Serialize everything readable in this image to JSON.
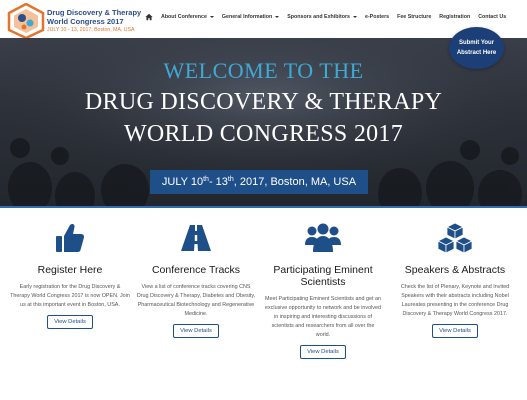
{
  "header": {
    "logo_title_line1": "Drug Discovery & Therapy",
    "logo_title_line2": "World Congress 2017",
    "logo_subtitle": "JULY 10 - 13, 2017, Boston, MA, USA",
    "nav": [
      {
        "label": "About Conference",
        "dropdown": true
      },
      {
        "label": "General Information",
        "dropdown": true
      },
      {
        "label": "Sponsors and Exhibitors",
        "dropdown": true
      },
      {
        "label": "e-Posters",
        "dropdown": false
      },
      {
        "label": "Fee Structure",
        "dropdown": false
      },
      {
        "label": "Registration",
        "dropdown": false
      },
      {
        "label": "Contact Us",
        "dropdown": false
      }
    ],
    "submit_label": "Submit Your Abstract Here"
  },
  "hero": {
    "line1": "WELCOME TO THE",
    "line2": "DRUG DISCOVERY & THERAPY",
    "line3": "WORLD CONGRESS 2017",
    "date_part1": "JULY 10",
    "date_sup1": "th",
    "date_part2": " - 13",
    "date_sup2": "th",
    "date_part3": ", 2017, Boston, MA, USA"
  },
  "features": [
    {
      "icon": "thumbs-up-icon",
      "title": "Register Here",
      "description": "Early registration for the Drug Discovery & Therapy World Congress 2017 is now OPEN. Join us at this important event in Boston, USA.",
      "button": "View Details"
    },
    {
      "icon": "road-icon",
      "title": "Conference Tracks",
      "description": "View a list of conference tracks covering CNS Drug Discovery & Therapy, Diabetes and Obesity, Pharmaceutical Biotechnology and Regenerative Medicine.",
      "button": "View Details"
    },
    {
      "icon": "users-icon",
      "title": "Participating Eminent Scientists",
      "description": "Meet Participating Eminent Scientists and get an exclusive opportunity to network and be involved in inspiring and interesting discussions of scientists and researchers from all over the world.",
      "button": "View Details"
    },
    {
      "icon": "cubes-icon",
      "title": "Speakers & Abstracts",
      "description": "Check the list of Plenary, Keynote and Invited Speakers with their abstracts including Nobel Laureates presenting in the conference Drug Discovery & Therapy World Congress 2017.",
      "button": "View Details"
    }
  ],
  "colors": {
    "brand_navy": "#1f4f88",
    "accent_blue": "#3fa9d6",
    "logo_orange": "#e2742c"
  }
}
